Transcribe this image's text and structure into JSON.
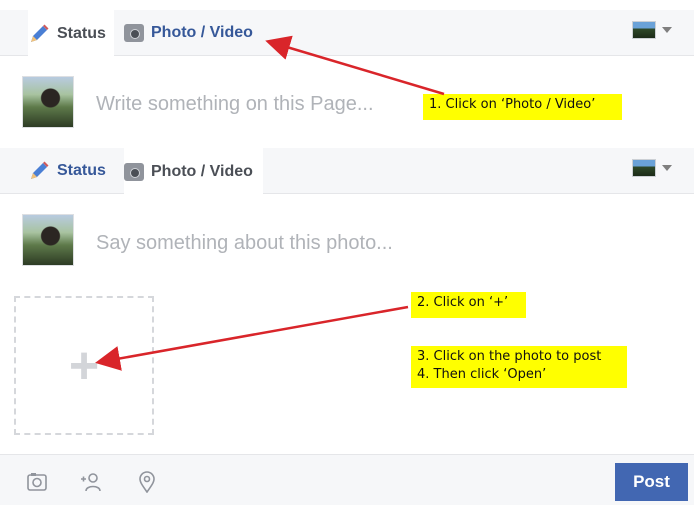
{
  "composer_collapsed": {
    "tabs": {
      "status": "Status",
      "photo_video": "Photo / Video"
    },
    "placeholder": "Write something on this Page..."
  },
  "composer_expanded": {
    "tabs": {
      "status": "Status",
      "photo_video": "Photo / Video"
    },
    "placeholder": "Say something about this photo...",
    "add_photo_symbol": "+",
    "post_button": "Post"
  },
  "annotations": {
    "step1": "1. Click on ‘Photo / Video’",
    "step2": "2. Click on ‘+’",
    "step3": "3. Click on the photo to post",
    "step4": "4. Then click ‘Open’"
  },
  "colors": {
    "link_blue": "#365899",
    "post_button": "#4267b2",
    "callout_yellow": "#ffff00",
    "arrow_red": "#d9252a"
  },
  "icons": [
    "pencil-icon",
    "camera-icon",
    "page-thumbnail",
    "caret-down-icon",
    "photo-icon",
    "tag-people-icon",
    "location-icon"
  ]
}
